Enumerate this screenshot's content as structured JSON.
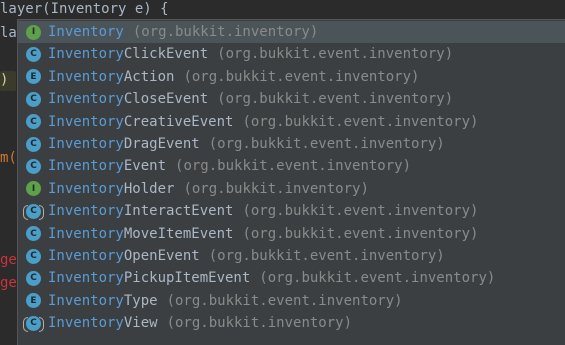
{
  "editor": {
    "top_line_prefix": "layer(",
    "top_line_type": "Inventory",
    "top_line_suffix": " e) {",
    "frag_la": "la",
    "frag_paren": ")",
    "frag_m": "m(",
    "frag_ge1": "ge",
    "frag_ge2": "ge"
  },
  "popup": {
    "items": [
      {
        "match": "Inventory",
        "rest": "",
        "pkg": "(org.bukkit.inventory)",
        "icon": "I",
        "kind": "interface",
        "icon_name": "interface-icon"
      },
      {
        "match": "Inventory",
        "rest": "ClickEvent",
        "pkg": "(org.bukkit.event.inventory)",
        "icon": "C",
        "kind": "class",
        "icon_name": "class-icon"
      },
      {
        "match": "Inventory",
        "rest": "Action",
        "pkg": "(org.bukkit.event.inventory)",
        "icon": "E",
        "kind": "enum",
        "icon_name": "enum-icon"
      },
      {
        "match": "Inventory",
        "rest": "CloseEvent",
        "pkg": "(org.bukkit.event.inventory)",
        "icon": "C",
        "kind": "class",
        "icon_name": "class-icon"
      },
      {
        "match": "Inventory",
        "rest": "CreativeEvent",
        "pkg": "(org.bukkit.event.inventory)",
        "icon": "C",
        "kind": "class",
        "icon_name": "class-icon"
      },
      {
        "match": "Inventory",
        "rest": "DragEvent",
        "pkg": "(org.bukkit.event.inventory)",
        "icon": "C",
        "kind": "class",
        "icon_name": "class-icon"
      },
      {
        "match": "Inventory",
        "rest": "Event",
        "pkg": "(org.bukkit.event.inventory)",
        "icon": "C",
        "kind": "class",
        "icon_name": "class-icon"
      },
      {
        "match": "Inventory",
        "rest": "Holder",
        "pkg": "(org.bukkit.inventory)",
        "icon": "I",
        "kind": "interface",
        "icon_name": "interface-icon"
      },
      {
        "match": "Inventory",
        "rest": "InteractEvent",
        "pkg": "(org.bukkit.event.inventory)",
        "icon": "C",
        "kind": "abstract",
        "icon_name": "abstract-class-icon"
      },
      {
        "match": "Inventory",
        "rest": "MoveItemEvent",
        "pkg": "(org.bukkit.event.inventory)",
        "icon": "C",
        "kind": "class",
        "icon_name": "class-icon"
      },
      {
        "match": "Inventory",
        "rest": "OpenEvent",
        "pkg": "(org.bukkit.event.inventory)",
        "icon": "C",
        "kind": "class",
        "icon_name": "class-icon"
      },
      {
        "match": "Inventory",
        "rest": "PickupItemEvent",
        "pkg": "(org.bukkit.event.inventory)",
        "icon": "C",
        "kind": "class",
        "icon_name": "class-icon"
      },
      {
        "match": "Inventory",
        "rest": "Type",
        "pkg": "(org.bukkit.event.inventory)",
        "icon": "E",
        "kind": "enum",
        "icon_name": "enum-icon"
      },
      {
        "match": "Inventory",
        "rest": "View",
        "pkg": "(org.bukkit.inventory)",
        "icon": "C",
        "kind": "abstract",
        "icon_name": "abstract-class-icon"
      }
    ],
    "selected_index": 0
  },
  "colors": {
    "background": "#2b2b2b",
    "popup_background": "#3c3f41",
    "selected_row": "#4b5559",
    "match_text": "#5b9bd5",
    "class_icon": "#4a9ec8",
    "interface_icon": "#5fa04a"
  }
}
